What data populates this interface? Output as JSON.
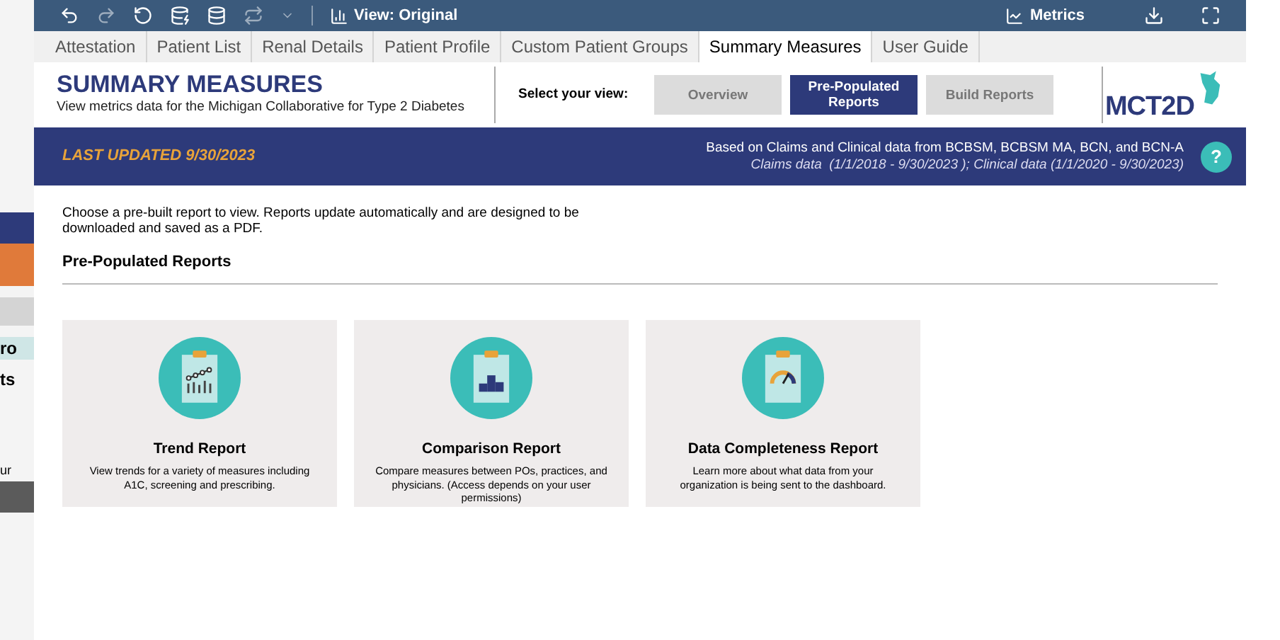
{
  "background_window": {
    "fragments": [
      "ro",
      "ts",
      "ur"
    ]
  },
  "toolbar": {
    "view_label": "View: Original",
    "metrics_label": "Metrics"
  },
  "tabs": [
    {
      "label": "Attestation",
      "selected": false
    },
    {
      "label": "Patient List",
      "selected": false
    },
    {
      "label": "Renal Details",
      "selected": false
    },
    {
      "label": "Patient Profile",
      "selected": false
    },
    {
      "label": "Custom Patient Groups",
      "selected": false
    },
    {
      "label": "Summary Measures",
      "selected": true
    },
    {
      "label": "User Guide",
      "selected": false
    }
  ],
  "header": {
    "title": "SUMMARY MEASURES",
    "subtitle": "View metrics data for the Michigan Collaborative for Type 2 Diabetes",
    "select_label": "Select your view:",
    "logo_text": "MCT2D",
    "view_buttons": [
      {
        "label": "Overview",
        "selected": false
      },
      {
        "label": "Pre-Populated Reports",
        "selected": true
      },
      {
        "label": "Build Reports",
        "selected": false
      }
    ]
  },
  "banner": {
    "last_updated": "LAST UPDATED 9/30/2023",
    "source": "Based on Claims and Clinical data from BCBSM, BCBSM MA, BCN, and BCN-A",
    "dates": "Claims data  (1/1/2018 - 9/30/2023 ); Clinical data (1/1/2020 - 9/30/2023)",
    "help": "?"
  },
  "intro": "Choose a pre-built report to view. Reports update automatically and are designed to be downloaded and saved as a PDF.",
  "section_title": "Pre-Populated Reports",
  "reports": [
    {
      "kind": "trend",
      "title": "Trend Report",
      "description": "View trends for a variety of measures including A1C, screening and prescribing."
    },
    {
      "kind": "comparison",
      "title": "Comparison Report",
      "description": "Compare measures between POs, practices, and physicians. (Access depends on your user permissions)"
    },
    {
      "kind": "completeness",
      "title": "Data Completeness Report",
      "description": "Learn more about what data from your organization is being sent to the dashboard."
    }
  ]
}
